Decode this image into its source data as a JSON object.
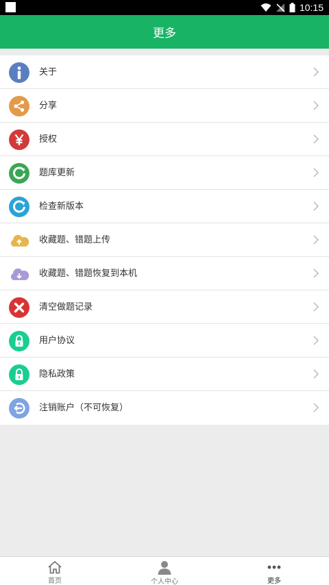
{
  "status_bar": {
    "time": "10:15"
  },
  "header": {
    "title": "更多"
  },
  "menu": [
    {
      "label": "关于",
      "icon": "info-icon",
      "color": "#5b7ec0"
    },
    {
      "label": "分享",
      "icon": "share-icon",
      "color": "#e39a4b"
    },
    {
      "label": "授权",
      "icon": "yen-icon",
      "color": "#d23a3a"
    },
    {
      "label": "题库更新",
      "icon": "refresh-green-icon",
      "color": "#3aa655"
    },
    {
      "label": "检查新版本",
      "icon": "refresh-blue-icon",
      "color": "#2aa3d6"
    },
    {
      "label": "收藏题、错题上传",
      "icon": "cloud-upload-icon",
      "color": "#e7b54e"
    },
    {
      "label": "收藏题、错题恢复到本机",
      "icon": "cloud-download-icon",
      "color": "#a79ad6"
    },
    {
      "label": "清空做题记录",
      "icon": "clear-x-icon",
      "color": "#d93434"
    },
    {
      "label": "用户协议",
      "icon": "lock-icon",
      "color": "#18cf90"
    },
    {
      "label": "隐私政策",
      "icon": "lock-icon",
      "color": "#18cf90"
    },
    {
      "label": "注销账户（不可恢复）",
      "icon": "logout-icon",
      "color": "#7fa3e3"
    }
  ],
  "tabs": [
    {
      "label": "首页",
      "icon": "home-icon"
    },
    {
      "label": "个人中心",
      "icon": "person-icon"
    },
    {
      "label": "更多",
      "icon": "more-dots-icon",
      "active": true
    }
  ]
}
